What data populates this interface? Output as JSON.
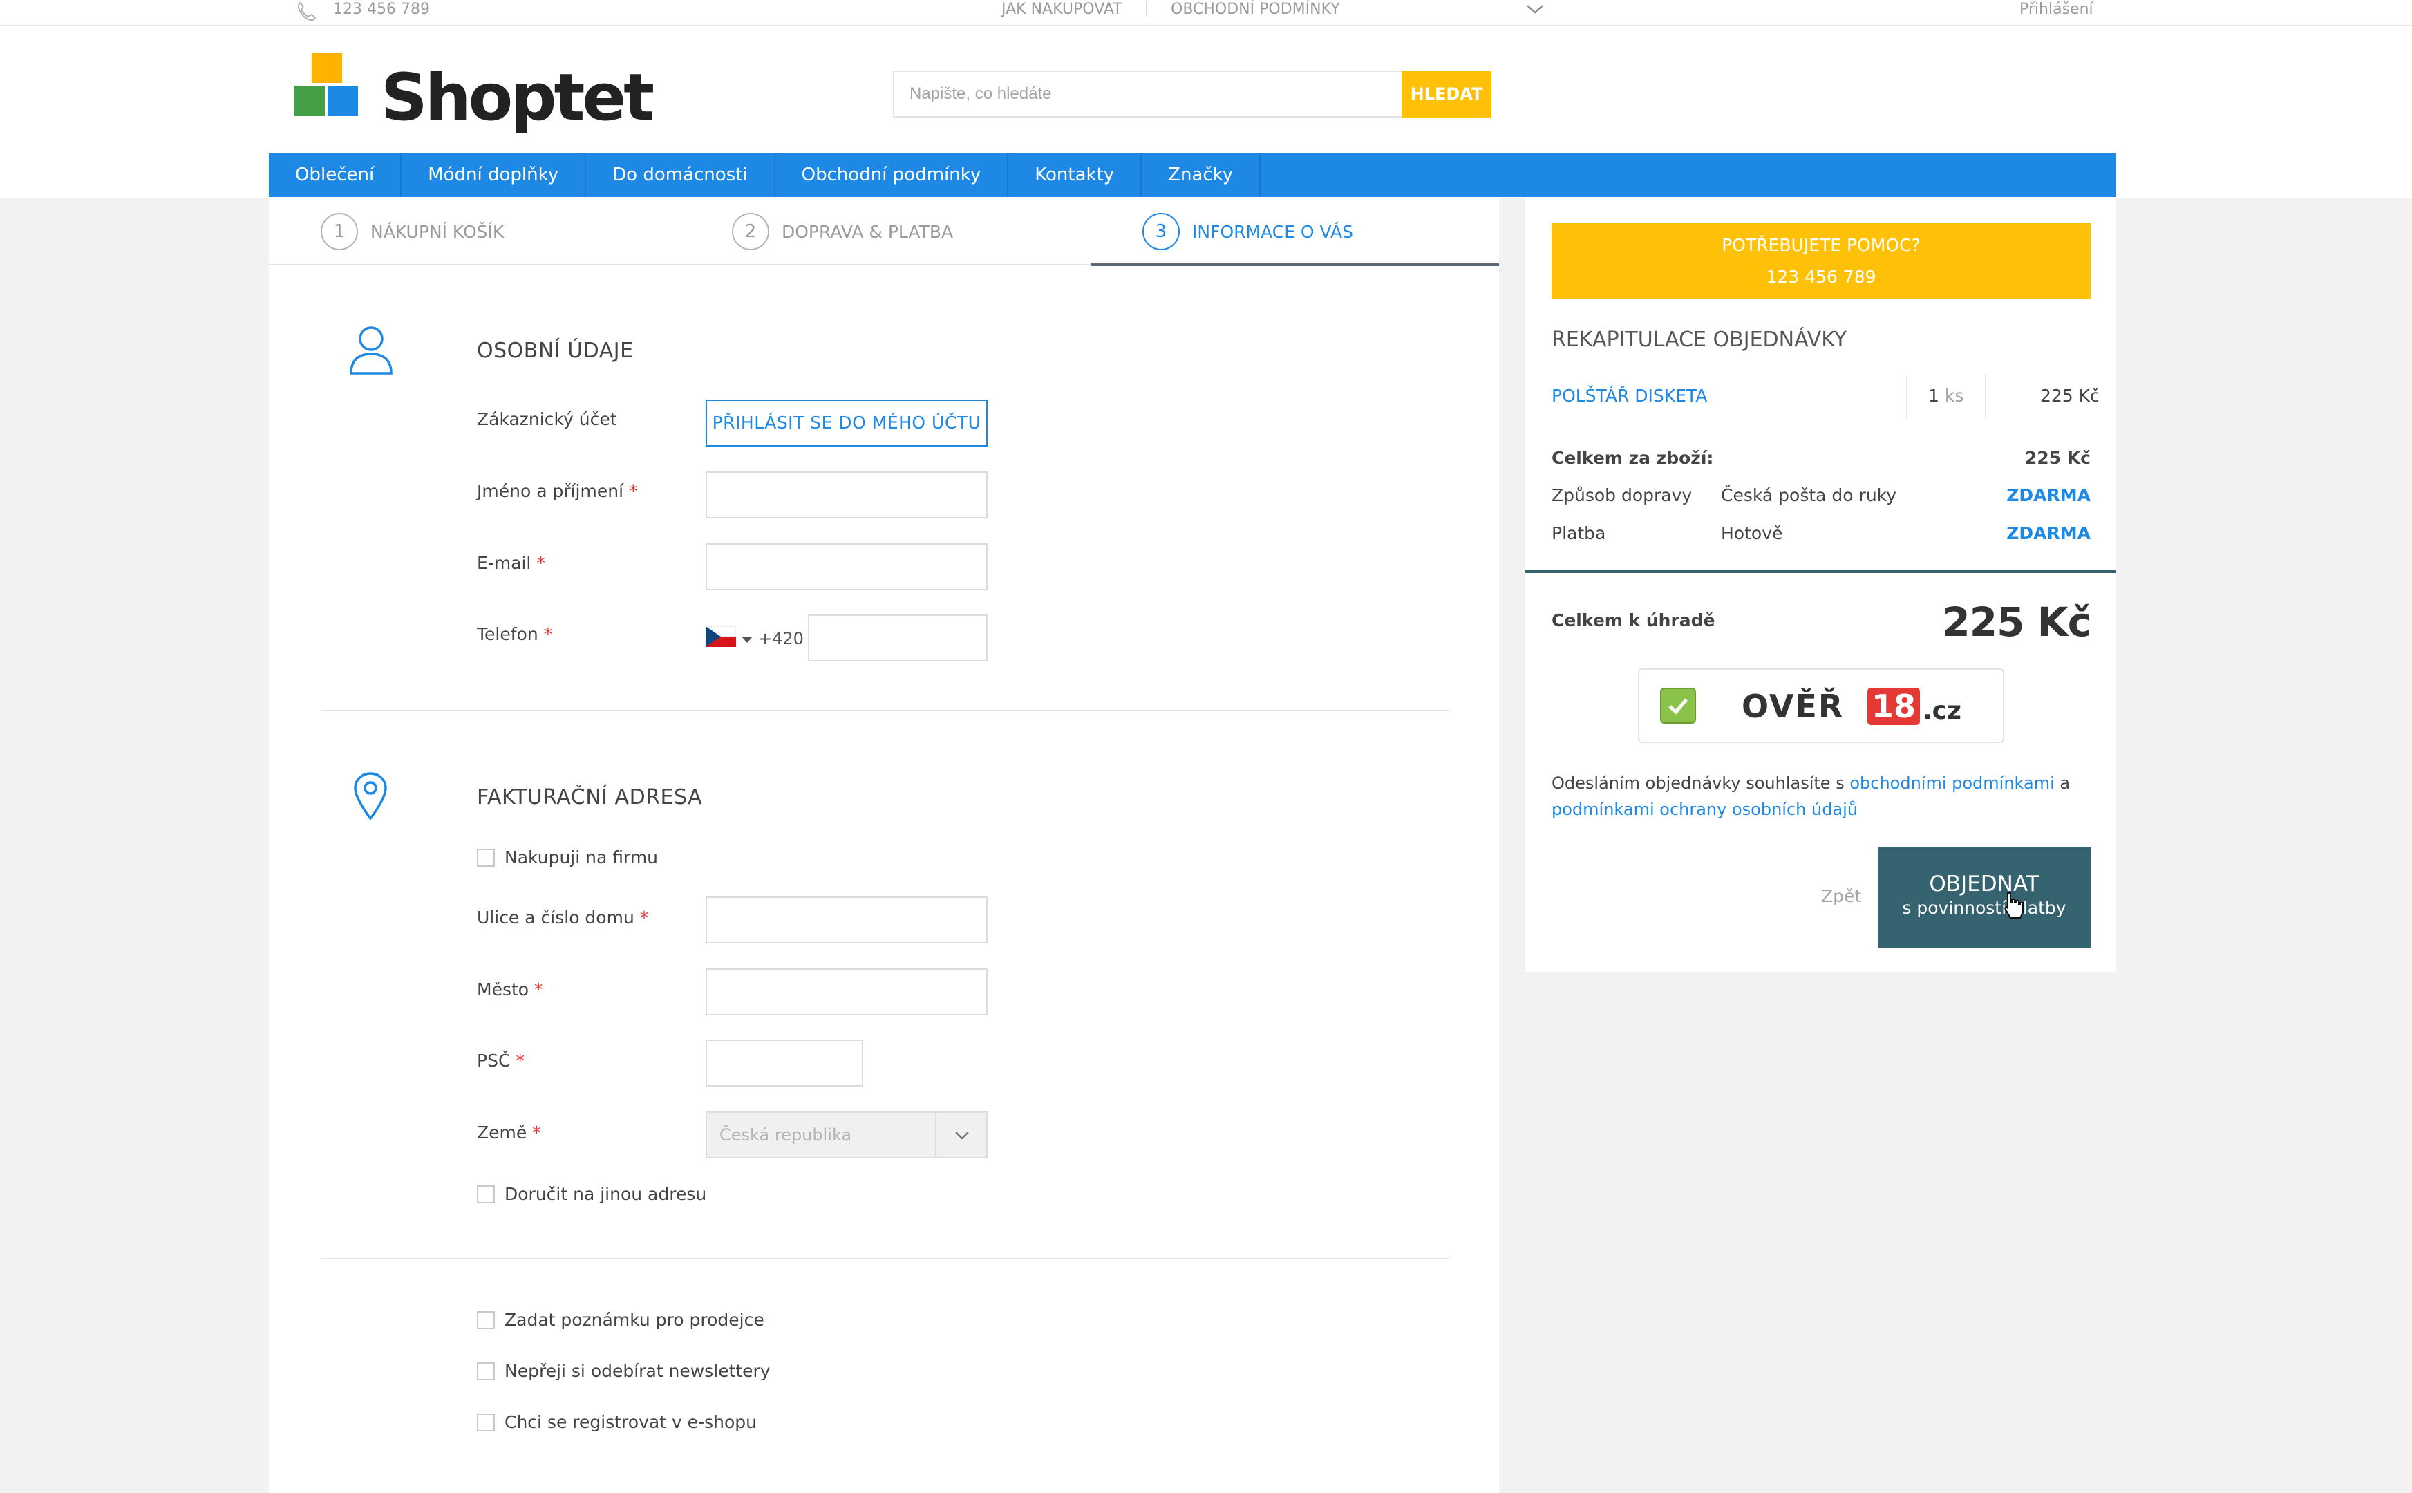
{
  "topbar": {
    "phone": "123 456 789",
    "links": [
      "JAK NAKUPOVAT",
      "OBCHODNÍ PODMÍNKY"
    ],
    "login": "Přihlášení"
  },
  "header": {
    "logo_text": "Shoptet",
    "search_placeholder": "Napište, co hledáte",
    "search_button": "HLEDAT"
  },
  "nav": {
    "items": [
      "Oblečení",
      "Módní doplňky",
      "Do domácnosti",
      "Obchodní podmínky",
      "Kontakty",
      "Značky"
    ]
  },
  "steps": [
    {
      "num": "1",
      "label": "NÁKUPNÍ KOŠÍK"
    },
    {
      "num": "2",
      "label": "DOPRAVA & PLATBA"
    },
    {
      "num": "3",
      "label": "INFORMACE O VÁS"
    }
  ],
  "personal": {
    "title": "OSOBNÍ ÚDAJE",
    "account_label": "Zákaznický účet",
    "login_button": "PŘIHLÁSIT SE DO MÉHO ÚČTU",
    "name_label": "Jméno a příjmení",
    "email_label": "E-mail",
    "phone_label": "Telefon",
    "phone_prefix": "+420",
    "required_mark": "*"
  },
  "billing": {
    "title": "FAKTURAČNÍ ADRESA",
    "company_checkbox": "Nakupuji na firmu",
    "street_label": "Ulice a číslo domu",
    "city_label": "Město",
    "zip_label": "PSČ",
    "country_label": "Země",
    "country_value": "Česká republika",
    "other_address_checkbox": "Doručit na jinou adresu"
  },
  "extras": {
    "note_checkbox": "Zadat poznámku pro prodejce",
    "newsletter_checkbox": "Nepřeji si odebírat newslettery",
    "register_checkbox": "Chci se registrovat v e-shopu"
  },
  "summary": {
    "help_title": "POTŘEBUJETE POMOC?",
    "help_phone": "123 456 789",
    "title": "REKAPITULACE OBJEDNÁVKY",
    "item_name": "POLŠTÁŘ DISKETA",
    "item_qty": "1",
    "item_unit": "ks",
    "item_price": "225 Kč",
    "subtotal_label": "Celkem za zboží:",
    "subtotal_value": "225 Kč",
    "shipping_label": "Způsob dopravy",
    "shipping_method": "Česká pošta do ruky",
    "shipping_price": "ZDARMA",
    "payment_label": "Platba",
    "payment_method": "Hotově",
    "payment_price": "ZDARMA",
    "total_label": "Celkem k úhradě",
    "total_value": "225 Kč",
    "verify_logo_text": "OVĚŘ",
    "verify_logo_num": "18",
    "verify_logo_tld": ".cz",
    "consent_prefix": "Odesláním objednávky souhlasíte s",
    "consent_link1": "obchodními podmínkami",
    "consent_and": "a",
    "consent_link2": "podmínkami ochrany osobních údajů",
    "back_link": "Zpět",
    "order_button": "OBJEDNAT",
    "order_button_sub": "s povinností platby"
  }
}
